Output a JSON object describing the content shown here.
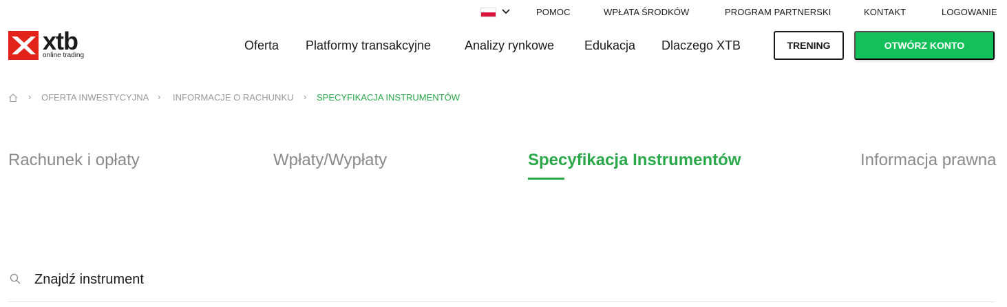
{
  "topbar": {
    "language": "PL",
    "links": [
      "POMOC",
      "WPŁATA ŚRODKÓW",
      "PROGRAM PARTNERSKI",
      "KONTAKT",
      "LOGOWANIE"
    ]
  },
  "logo": {
    "name": "xtb",
    "tagline": "online trading",
    "color": "#e2231a"
  },
  "nav": {
    "items": [
      "Oferta",
      "Platformy transakcyjne",
      "Analizy rynkowe",
      "Edukacja",
      "Dlaczego XTB"
    ],
    "trening_label": "TRENING",
    "open_account_label": "OTWÓRZ KONTO"
  },
  "breadcrumb": {
    "items": [
      "OFERTA INWESTYCYJNA",
      "INFORMACJE O RACHUNKU",
      "SPECYFIKACJA INSTRUMENTÓW"
    ]
  },
  "tabs": {
    "items": [
      "Rachunek i opłaty",
      "Wpłaty/Wypłaty",
      "Specyfikacja Instrumentów",
      "Informacja prawna"
    ],
    "active_index": 2
  },
  "search": {
    "placeholder": "Znajdź instrument"
  },
  "colors": {
    "accent_green": "#2aa84a",
    "button_green": "#13c05a",
    "brand_red": "#e2231a"
  }
}
